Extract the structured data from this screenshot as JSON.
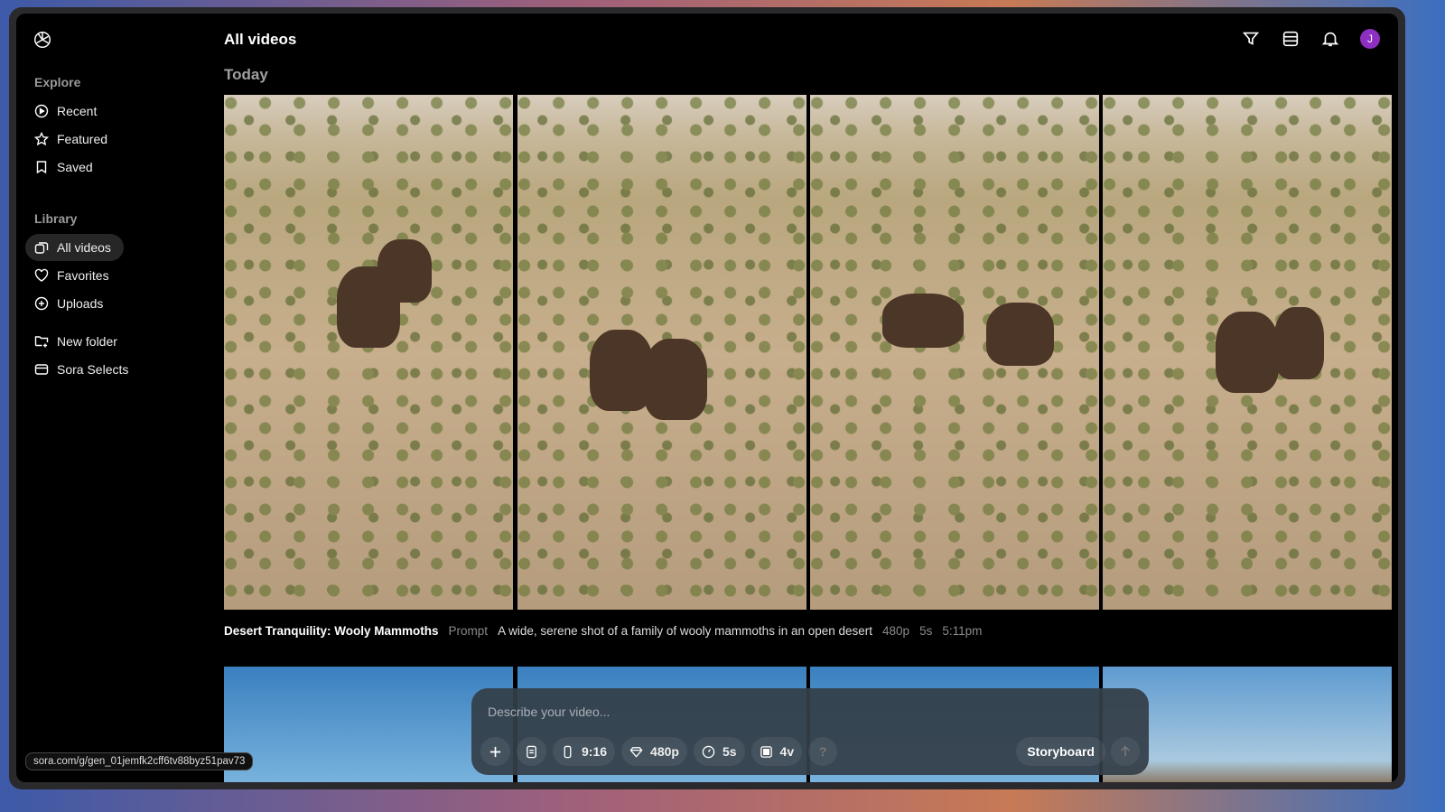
{
  "header": {
    "title": "All videos",
    "section": "Today"
  },
  "sidebar": {
    "explore_label": "Explore",
    "library_label": "Library",
    "explore": [
      {
        "label": "Recent"
      },
      {
        "label": "Featured"
      },
      {
        "label": "Saved"
      }
    ],
    "library": [
      {
        "label": "All videos"
      },
      {
        "label": "Favorites"
      },
      {
        "label": "Uploads"
      }
    ],
    "folders": [
      {
        "label": "New folder"
      },
      {
        "label": "Sora Selects"
      }
    ]
  },
  "user": {
    "initial": "J",
    "avatar_color": "#8e2fc2"
  },
  "video": {
    "title": "Desert Tranquility: Wooly Mammoths",
    "prompt_label": "Prompt",
    "prompt": "A wide, serene shot of a family of wooly mammoths in an open desert",
    "resolution": "480p",
    "duration": "5s",
    "time": "5:11pm"
  },
  "composer": {
    "placeholder": "Describe your video...",
    "aspect": "9:16",
    "resolution": "480p",
    "duration": "5s",
    "variations": "4v",
    "help": "?",
    "storyboard": "Storyboard"
  },
  "status_url": "sora.com/g/gen_01jemfk2cff6tv88byz51pav73"
}
